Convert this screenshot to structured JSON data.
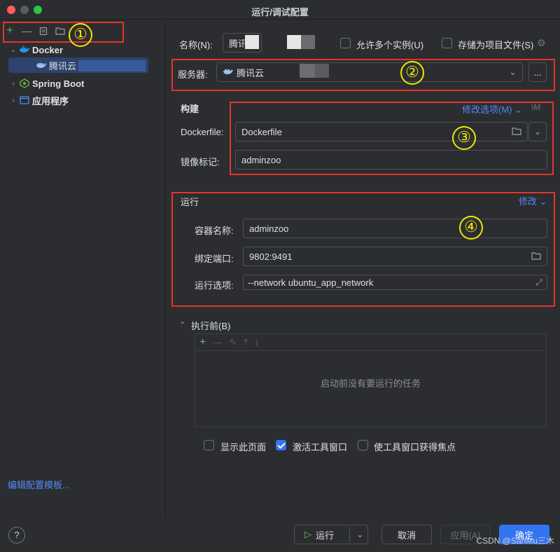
{
  "window": {
    "title": "运行/调试配置"
  },
  "sidebar": {
    "toolbar": [
      "plus-icon",
      "minus-icon",
      "copy-icon",
      "folder-icon"
    ],
    "tree": [
      {
        "label": "Docker",
        "icon": "docker-icon",
        "expanded": true
      },
      {
        "label": "腾讯云",
        "icon": "docker-icon",
        "selected": true
      },
      {
        "label": "Spring Boot",
        "icon": "spring-boot-icon",
        "expanded": false
      },
      {
        "label": "应用程序",
        "icon": "application-icon",
        "expanded": false
      }
    ],
    "edit_templates_link": "编辑配置模板..."
  },
  "header": {
    "name_label": "名称(N):",
    "name_value": "腾讯",
    "allow_multiple_label": "允许多个实例(U)",
    "store_as_project_label": "存储为项目文件(S)"
  },
  "server": {
    "label": "服务器:",
    "value": "腾讯云",
    "more_button": "..."
  },
  "build": {
    "title": "构建",
    "modify_options": "修改选项(M)",
    "shortcut_hint": "\\M",
    "dockerfile_label": "Dockerfile:",
    "dockerfile_value": "Dockerfile",
    "image_tag_label": "镜像标记:",
    "image_tag_value": "adminzoo"
  },
  "run": {
    "title": "运行",
    "modify": "修改",
    "container_name_label": "容器名称:",
    "container_name_value": "adminzoo",
    "bind_ports_label": "绑定端口:",
    "bind_ports_value": "9802:9491",
    "run_options_label": "运行选项:",
    "run_options_value": "--network ubuntu_app_network"
  },
  "before_launch": {
    "title": "执行前(B)",
    "empty_text": "启动前没有要运行的任务",
    "show_page_label": "显示此页面",
    "activate_tool_window_label": "激活工具窗口",
    "focus_tool_window_label": "使工具窗口获得焦点",
    "show_page_checked": false,
    "activate_tool_window_checked": true,
    "focus_tool_window_checked": false
  },
  "annotations": [
    "①",
    "②",
    "③",
    "④"
  ],
  "footer": {
    "help": "?",
    "run_button": "运行",
    "cancel_button": "取消",
    "apply_button": "应用(A)",
    "ok_button": "确定",
    "watermark": "CSDN @SanMu三木"
  },
  "colors": {
    "background": "#2b2d30",
    "accent": "#3574f0",
    "link": "#548af7",
    "annotation_box": "#e8332a",
    "annotation_number": "#f2e600"
  }
}
